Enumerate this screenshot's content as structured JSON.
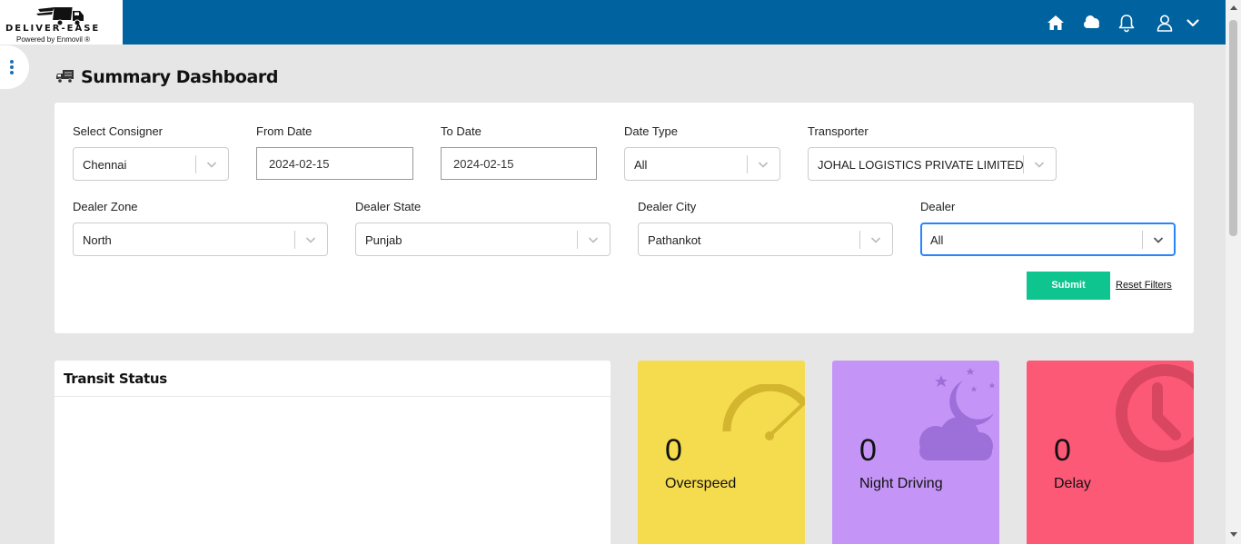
{
  "brand": {
    "logo_text": "DELIVER-EASE",
    "powered_by": "Powered by Enmovil ®"
  },
  "header_icons": [
    "home-icon",
    "weather-icon",
    "bell-icon",
    "user-icon",
    "chevron-down-icon"
  ],
  "page": {
    "title": "Summary Dashboard"
  },
  "filters": {
    "consigner": {
      "label": "Select Consigner",
      "value": "Chennai"
    },
    "from_date": {
      "label": "From Date",
      "value": "2024-02-15"
    },
    "to_date": {
      "label": "To Date",
      "value": "2024-02-15"
    },
    "date_type": {
      "label": "Date Type",
      "value": "All"
    },
    "transporter": {
      "label": "Transporter",
      "value": "JOHAL LOGISTICS PRIVATE LIMITED"
    },
    "dealer_zone": {
      "label": "Dealer Zone",
      "value": "North"
    },
    "dealer_state": {
      "label": "Dealer State",
      "value": "Punjab"
    },
    "dealer_city": {
      "label": "Dealer City",
      "value": "Pathankot"
    },
    "dealer": {
      "label": "Dealer",
      "value": "All"
    },
    "submit_label": "Submit",
    "reset_label": "Reset Filters"
  },
  "transit": {
    "title": "Transit Status"
  },
  "stats": [
    {
      "count": "0",
      "label": "Overspeed",
      "color": "#f5dc4e",
      "icon": "speedometer-icon"
    },
    {
      "count": "0",
      "label": "Night Driving",
      "color": "#c495f7",
      "icon": "night-moon-icon"
    },
    {
      "count": "0",
      "label": "Delay",
      "color": "#fc5977",
      "icon": "clock-icon"
    }
  ],
  "colors": {
    "header": "#00629f",
    "submit": "#0ec48f",
    "focus": "#2684ff"
  }
}
